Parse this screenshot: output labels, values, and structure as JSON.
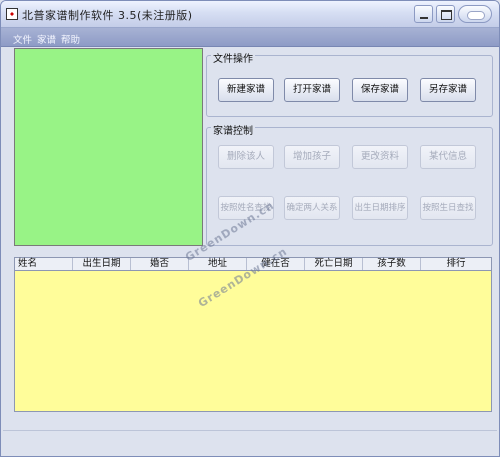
{
  "window": {
    "title": "北普家谱制作软件 3.5(未注册版)"
  },
  "menu": {
    "items": [
      "文件",
      "家谱",
      "帮助"
    ]
  },
  "file_group": {
    "title": "文件操作",
    "buttons": [
      "新建家谱",
      "打开家谱",
      "保存家谱",
      "另存家谱"
    ]
  },
  "control_group": {
    "title": "家谱控制",
    "row1": [
      "删除该人",
      "增加孩子",
      "更改资料",
      "某代信息"
    ],
    "row2": [
      "按照姓名查找",
      "确定两人关系",
      "出生日期排序",
      "按照生日查找"
    ]
  },
  "table": {
    "columns": [
      "姓名",
      "出生日期",
      "婚否",
      "地址",
      "健在否",
      "死亡日期",
      "孩子数",
      "排行"
    ]
  },
  "watermark": {
    "text": "GreenDown.cn"
  },
  "colors": {
    "photo_panel": "#98f386",
    "table_body": "#fffd9a",
    "menubar": "#8e9bc6"
  }
}
